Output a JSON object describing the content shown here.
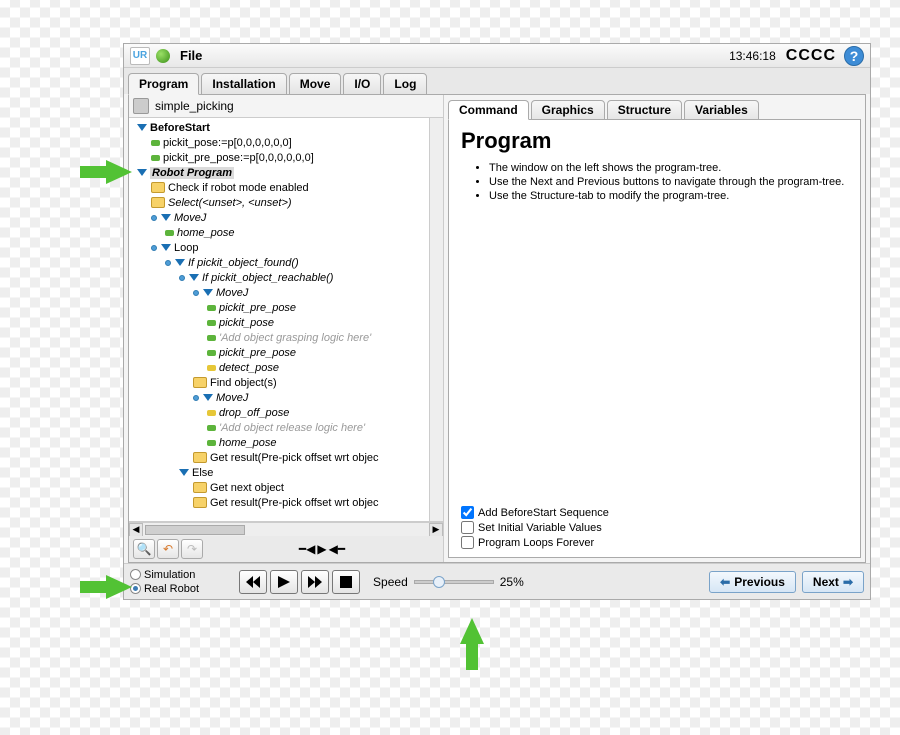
{
  "top": {
    "file": "File",
    "time": "13:46:18",
    "cccc": "CCCC"
  },
  "mainTabs": [
    "Program",
    "Installation",
    "Move",
    "I/O",
    "Log"
  ],
  "programName": "simple_picking",
  "tree": [
    {
      "d": 0,
      "icon": "tri",
      "text": "BeforeStart",
      "bold": true
    },
    {
      "d": 1,
      "icon": "g",
      "text": "pickit_pose:=p[0,0,0,0,0,0]"
    },
    {
      "d": 1,
      "icon": "g",
      "text": "pickit_pre_pose:=p[0,0,0,0,0,0]"
    },
    {
      "d": 0,
      "icon": "tri",
      "text": "Robot Program",
      "bold": true,
      "italic": true,
      "hl": true
    },
    {
      "d": 1,
      "icon": "folder",
      "text": "Check if robot mode enabled"
    },
    {
      "d": 1,
      "icon": "folder",
      "text": "Select(<unset>, <unset>)",
      "italic": true
    },
    {
      "d": 1,
      "icon": "tri",
      "text": "MoveJ",
      "italic": true,
      "circ": true
    },
    {
      "d": 2,
      "icon": "g",
      "text": "home_pose",
      "italic": true
    },
    {
      "d": 1,
      "icon": "tri",
      "text": "Loop",
      "circ": true
    },
    {
      "d": 2,
      "icon": "tri",
      "text": "If pickit_object_found()",
      "italic": true,
      "circ": true
    },
    {
      "d": 3,
      "icon": "tri",
      "text": "If pickit_object_reachable()",
      "italic": true,
      "circ": true
    },
    {
      "d": 4,
      "icon": "tri",
      "text": "MoveJ",
      "italic": true,
      "circ": true
    },
    {
      "d": 5,
      "icon": "g",
      "text": "pickit_pre_pose",
      "italic": true
    },
    {
      "d": 5,
      "icon": "g",
      "text": "pickit_pose",
      "italic": true
    },
    {
      "d": 5,
      "icon": "g",
      "text": "'Add object grasping logic here'",
      "italic": true,
      "grey": true
    },
    {
      "d": 5,
      "icon": "g",
      "text": "pickit_pre_pose",
      "italic": true
    },
    {
      "d": 5,
      "icon": "y",
      "text": "detect_pose",
      "italic": true
    },
    {
      "d": 4,
      "icon": "folder",
      "text": "Find object(s)"
    },
    {
      "d": 4,
      "icon": "tri",
      "text": "MoveJ",
      "italic": true,
      "circ": true
    },
    {
      "d": 5,
      "icon": "y",
      "text": "drop_off_pose",
      "italic": true
    },
    {
      "d": 5,
      "icon": "g",
      "text": "'Add object release logic here'",
      "italic": true,
      "grey": true
    },
    {
      "d": 5,
      "icon": "g",
      "text": "home_pose",
      "italic": true
    },
    {
      "d": 4,
      "icon": "folder",
      "text": "Get result(Pre-pick offset wrt objec"
    },
    {
      "d": 3,
      "icon": "tri",
      "text": "Else"
    },
    {
      "d": 4,
      "icon": "folder",
      "text": "Get next object"
    },
    {
      "d": 4,
      "icon": "folder",
      "text": "Get result(Pre-pick offset wrt objec"
    }
  ],
  "subTabs": [
    "Command",
    "Graphics",
    "Structure",
    "Variables"
  ],
  "command": {
    "title": "Program",
    "hints": [
      "The window on the left shows the program-tree.",
      "Use the Next and Previous buttons to navigate through the program-tree.",
      "Use the Structure-tab to modify the program-tree."
    ],
    "checks": {
      "before": "Add BeforeStart Sequence",
      "initial": "Set Initial Variable Values",
      "loops": "Program Loops Forever"
    }
  },
  "bottom": {
    "simulation": "Simulation",
    "real": "Real Robot",
    "speedLabel": "Speed",
    "speedValue": "25%",
    "previous": "Previous",
    "next": "Next"
  }
}
